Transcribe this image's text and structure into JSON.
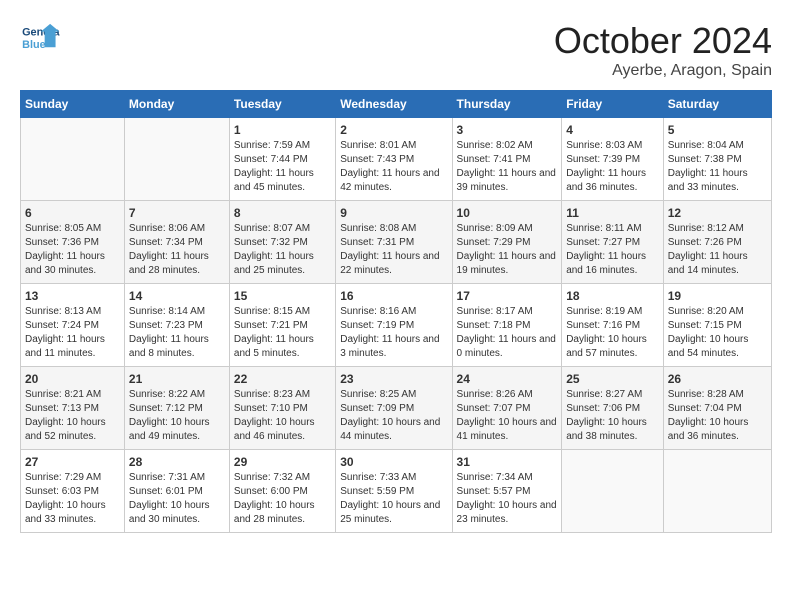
{
  "header": {
    "logo_general": "General",
    "logo_blue": "Blue",
    "month": "October 2024",
    "location": "Ayerbe, Aragon, Spain"
  },
  "weekdays": [
    "Sunday",
    "Monday",
    "Tuesday",
    "Wednesday",
    "Thursday",
    "Friday",
    "Saturday"
  ],
  "weeks": [
    [
      {
        "day": "",
        "sunrise": "",
        "sunset": "",
        "daylight": ""
      },
      {
        "day": "",
        "sunrise": "",
        "sunset": "",
        "daylight": ""
      },
      {
        "day": "1",
        "sunrise": "Sunrise: 7:59 AM",
        "sunset": "Sunset: 7:44 PM",
        "daylight": "Daylight: 11 hours and 45 minutes."
      },
      {
        "day": "2",
        "sunrise": "Sunrise: 8:01 AM",
        "sunset": "Sunset: 7:43 PM",
        "daylight": "Daylight: 11 hours and 42 minutes."
      },
      {
        "day": "3",
        "sunrise": "Sunrise: 8:02 AM",
        "sunset": "Sunset: 7:41 PM",
        "daylight": "Daylight: 11 hours and 39 minutes."
      },
      {
        "day": "4",
        "sunrise": "Sunrise: 8:03 AM",
        "sunset": "Sunset: 7:39 PM",
        "daylight": "Daylight: 11 hours and 36 minutes."
      },
      {
        "day": "5",
        "sunrise": "Sunrise: 8:04 AM",
        "sunset": "Sunset: 7:38 PM",
        "daylight": "Daylight: 11 hours and 33 minutes."
      }
    ],
    [
      {
        "day": "6",
        "sunrise": "Sunrise: 8:05 AM",
        "sunset": "Sunset: 7:36 PM",
        "daylight": "Daylight: 11 hours and 30 minutes."
      },
      {
        "day": "7",
        "sunrise": "Sunrise: 8:06 AM",
        "sunset": "Sunset: 7:34 PM",
        "daylight": "Daylight: 11 hours and 28 minutes."
      },
      {
        "day": "8",
        "sunrise": "Sunrise: 8:07 AM",
        "sunset": "Sunset: 7:32 PM",
        "daylight": "Daylight: 11 hours and 25 minutes."
      },
      {
        "day": "9",
        "sunrise": "Sunrise: 8:08 AM",
        "sunset": "Sunset: 7:31 PM",
        "daylight": "Daylight: 11 hours and 22 minutes."
      },
      {
        "day": "10",
        "sunrise": "Sunrise: 8:09 AM",
        "sunset": "Sunset: 7:29 PM",
        "daylight": "Daylight: 11 hours and 19 minutes."
      },
      {
        "day": "11",
        "sunrise": "Sunrise: 8:11 AM",
        "sunset": "Sunset: 7:27 PM",
        "daylight": "Daylight: 11 hours and 16 minutes."
      },
      {
        "day": "12",
        "sunrise": "Sunrise: 8:12 AM",
        "sunset": "Sunset: 7:26 PM",
        "daylight": "Daylight: 11 hours and 14 minutes."
      }
    ],
    [
      {
        "day": "13",
        "sunrise": "Sunrise: 8:13 AM",
        "sunset": "Sunset: 7:24 PM",
        "daylight": "Daylight: 11 hours and 11 minutes."
      },
      {
        "day": "14",
        "sunrise": "Sunrise: 8:14 AM",
        "sunset": "Sunset: 7:23 PM",
        "daylight": "Daylight: 11 hours and 8 minutes."
      },
      {
        "day": "15",
        "sunrise": "Sunrise: 8:15 AM",
        "sunset": "Sunset: 7:21 PM",
        "daylight": "Daylight: 11 hours and 5 minutes."
      },
      {
        "day": "16",
        "sunrise": "Sunrise: 8:16 AM",
        "sunset": "Sunset: 7:19 PM",
        "daylight": "Daylight: 11 hours and 3 minutes."
      },
      {
        "day": "17",
        "sunrise": "Sunrise: 8:17 AM",
        "sunset": "Sunset: 7:18 PM",
        "daylight": "Daylight: 11 hours and 0 minutes."
      },
      {
        "day": "18",
        "sunrise": "Sunrise: 8:19 AM",
        "sunset": "Sunset: 7:16 PM",
        "daylight": "Daylight: 10 hours and 57 minutes."
      },
      {
        "day": "19",
        "sunrise": "Sunrise: 8:20 AM",
        "sunset": "Sunset: 7:15 PM",
        "daylight": "Daylight: 10 hours and 54 minutes."
      }
    ],
    [
      {
        "day": "20",
        "sunrise": "Sunrise: 8:21 AM",
        "sunset": "Sunset: 7:13 PM",
        "daylight": "Daylight: 10 hours and 52 minutes."
      },
      {
        "day": "21",
        "sunrise": "Sunrise: 8:22 AM",
        "sunset": "Sunset: 7:12 PM",
        "daylight": "Daylight: 10 hours and 49 minutes."
      },
      {
        "day": "22",
        "sunrise": "Sunrise: 8:23 AM",
        "sunset": "Sunset: 7:10 PM",
        "daylight": "Daylight: 10 hours and 46 minutes."
      },
      {
        "day": "23",
        "sunrise": "Sunrise: 8:25 AM",
        "sunset": "Sunset: 7:09 PM",
        "daylight": "Daylight: 10 hours and 44 minutes."
      },
      {
        "day": "24",
        "sunrise": "Sunrise: 8:26 AM",
        "sunset": "Sunset: 7:07 PM",
        "daylight": "Daylight: 10 hours and 41 minutes."
      },
      {
        "day": "25",
        "sunrise": "Sunrise: 8:27 AM",
        "sunset": "Sunset: 7:06 PM",
        "daylight": "Daylight: 10 hours and 38 minutes."
      },
      {
        "day": "26",
        "sunrise": "Sunrise: 8:28 AM",
        "sunset": "Sunset: 7:04 PM",
        "daylight": "Daylight: 10 hours and 36 minutes."
      }
    ],
    [
      {
        "day": "27",
        "sunrise": "Sunrise: 7:29 AM",
        "sunset": "Sunset: 6:03 PM",
        "daylight": "Daylight: 10 hours and 33 minutes."
      },
      {
        "day": "28",
        "sunrise": "Sunrise: 7:31 AM",
        "sunset": "Sunset: 6:01 PM",
        "daylight": "Daylight: 10 hours and 30 minutes."
      },
      {
        "day": "29",
        "sunrise": "Sunrise: 7:32 AM",
        "sunset": "Sunset: 6:00 PM",
        "daylight": "Daylight: 10 hours and 28 minutes."
      },
      {
        "day": "30",
        "sunrise": "Sunrise: 7:33 AM",
        "sunset": "Sunset: 5:59 PM",
        "daylight": "Daylight: 10 hours and 25 minutes."
      },
      {
        "day": "31",
        "sunrise": "Sunrise: 7:34 AM",
        "sunset": "Sunset: 5:57 PM",
        "daylight": "Daylight: 10 hours and 23 minutes."
      },
      {
        "day": "",
        "sunrise": "",
        "sunset": "",
        "daylight": ""
      },
      {
        "day": "",
        "sunrise": "",
        "sunset": "",
        "daylight": ""
      }
    ]
  ]
}
